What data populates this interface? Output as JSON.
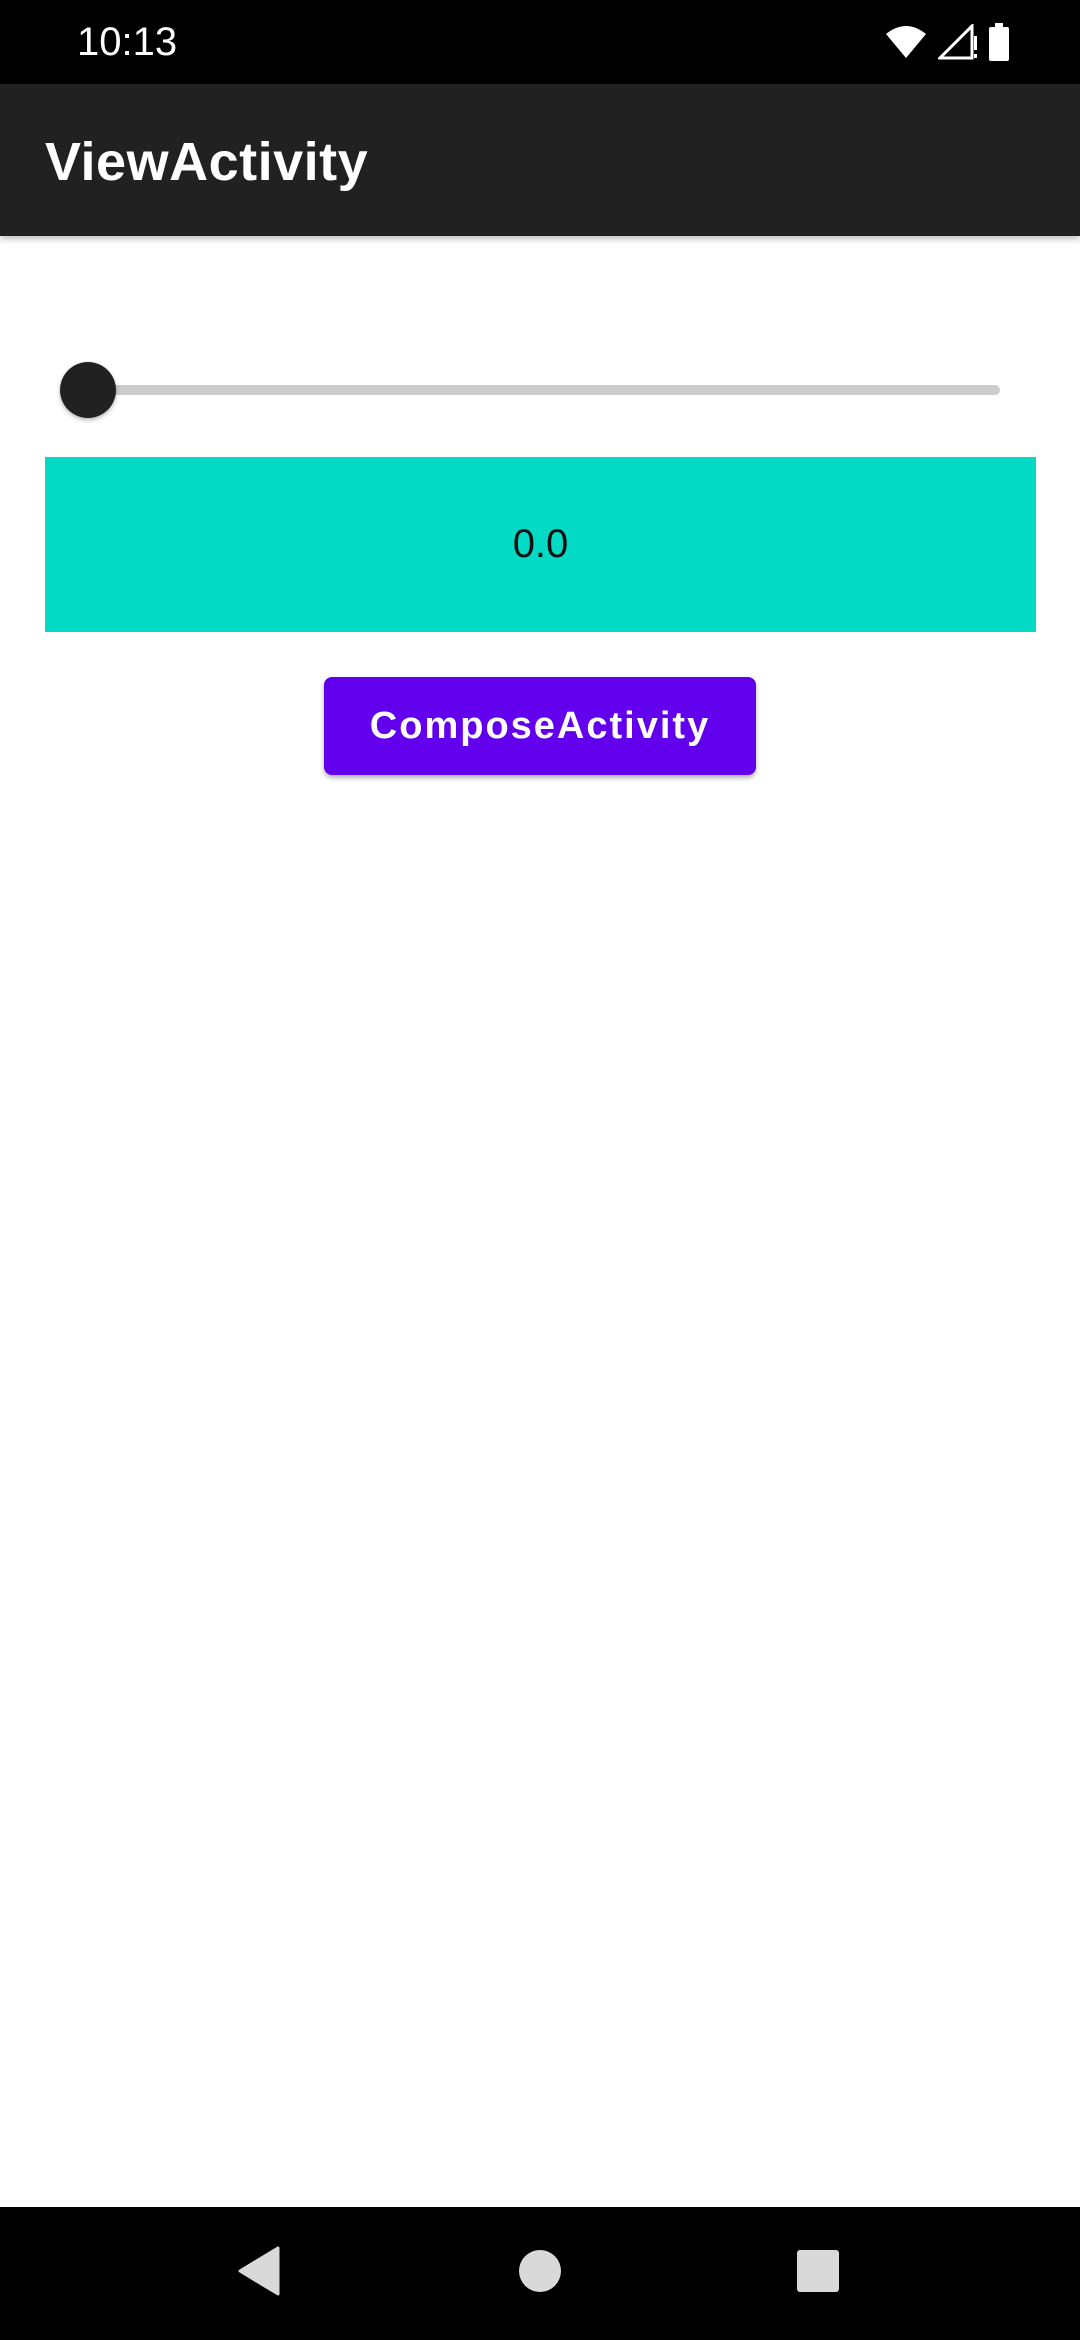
{
  "status_bar": {
    "time": "10:13",
    "icons": [
      "wifi-icon",
      "cell-signal-icon",
      "battery-icon"
    ]
  },
  "app_bar": {
    "title": "ViewActivity",
    "background": "#212121"
  },
  "slider": {
    "value": 0.0,
    "min": 0,
    "max": 1
  },
  "value_display": {
    "text": "0.0",
    "background": "#03dac5"
  },
  "compose_button": {
    "label": "ComposeActivity",
    "background": "#6200ee"
  },
  "nav_bar": {
    "buttons": [
      "back-icon",
      "home-icon",
      "recents-icon"
    ]
  }
}
